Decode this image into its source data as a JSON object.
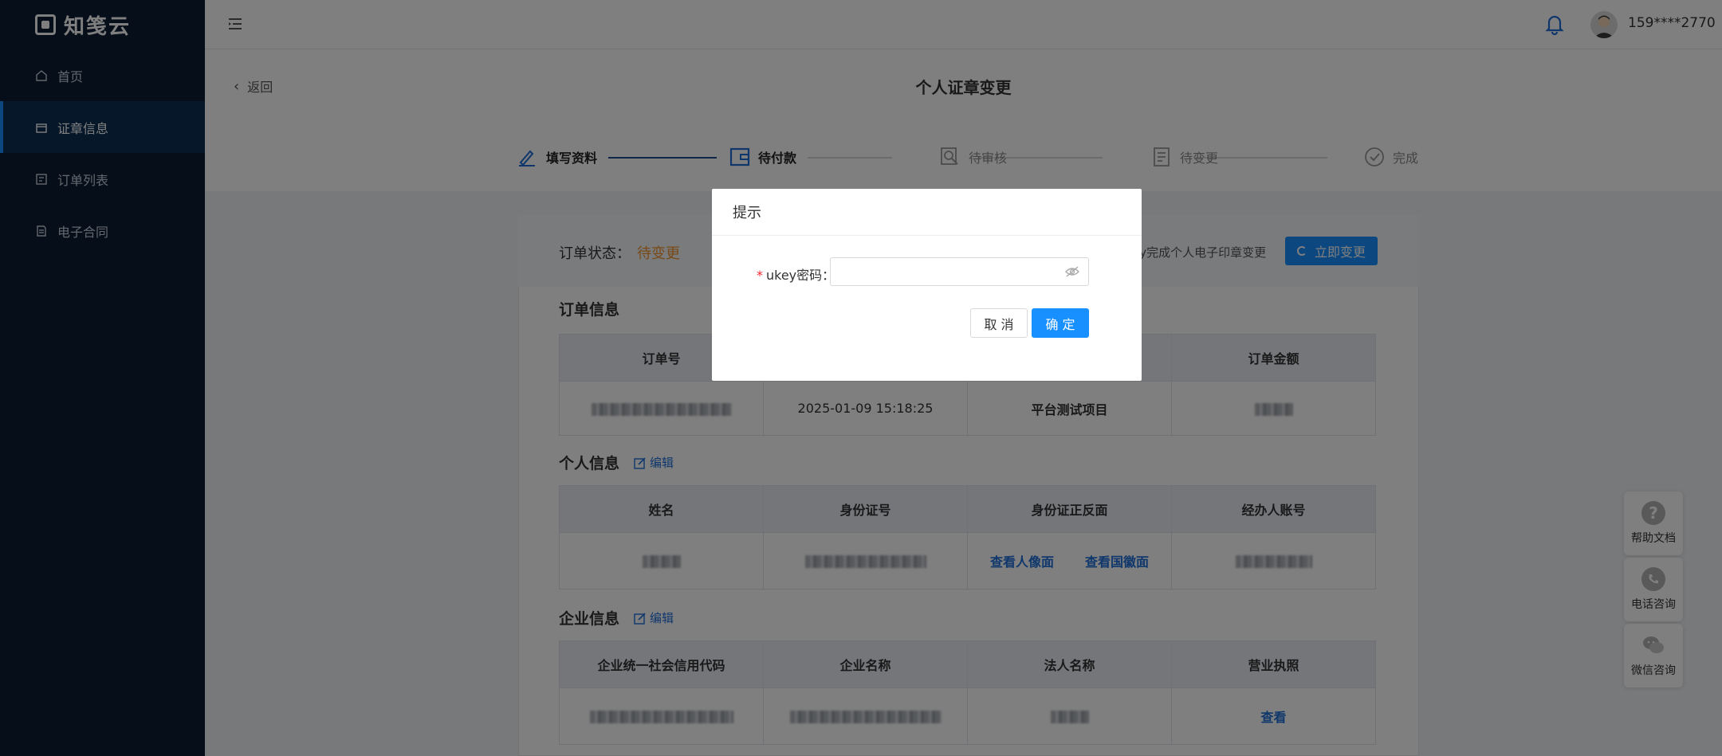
{
  "app": {
    "logo_text": "知笺云"
  },
  "sidebar": {
    "items": [
      {
        "label": "首页",
        "icon": "home-icon"
      },
      {
        "label": "证章信息",
        "icon": "seal-icon"
      },
      {
        "label": "订单列表",
        "icon": "order-list-icon"
      },
      {
        "label": "电子合同",
        "icon": "contract-icon"
      }
    ]
  },
  "topbar": {
    "username": "159****2770"
  },
  "page": {
    "back_label": "返回",
    "title": "个人证章变更"
  },
  "steps": [
    {
      "label": "填写资料",
      "state": "done"
    },
    {
      "label": "待付款",
      "state": "done"
    },
    {
      "label": "待审核",
      "state": "pending"
    },
    {
      "label": "待变更",
      "state": "pending"
    },
    {
      "label": "完成",
      "state": "pending"
    }
  ],
  "status": {
    "label": "订单状态：",
    "value": "待变更",
    "tip": "ey完成个人电子印章变更",
    "button_label": "立即变更"
  },
  "order_info": {
    "title": "订单信息",
    "headers": [
      "订单号",
      "",
      "",
      "订单金额"
    ],
    "row": {
      "created": "2025-01-09 15:18:25",
      "project": "平台测试项目"
    }
  },
  "personal_info": {
    "title": "个人信息",
    "edit_label": "编辑",
    "headers": [
      "姓名",
      "身份证号",
      "身份证正反面",
      "经办人账号"
    ],
    "links": {
      "front": "查看人像面",
      "back": "查看国徽面"
    }
  },
  "company_info": {
    "title": "企业信息",
    "edit_label": "编辑",
    "headers": [
      "企业统一社会信用代码",
      "企业名称",
      "法人名称",
      "营业执照"
    ],
    "view_label": "查看"
  },
  "float": {
    "help": "帮助文档",
    "phone": "电话咨询",
    "wechat": "微信咨询"
  },
  "modal": {
    "title": "提示",
    "field_label": "ukey密码：",
    "field_required": "*",
    "field_value": "",
    "cancel_label": "取 消",
    "ok_label": "确 定"
  },
  "colors": {
    "accent": "#1890ff",
    "sidebar": "#0b1c33",
    "warning": "#f0952e"
  }
}
